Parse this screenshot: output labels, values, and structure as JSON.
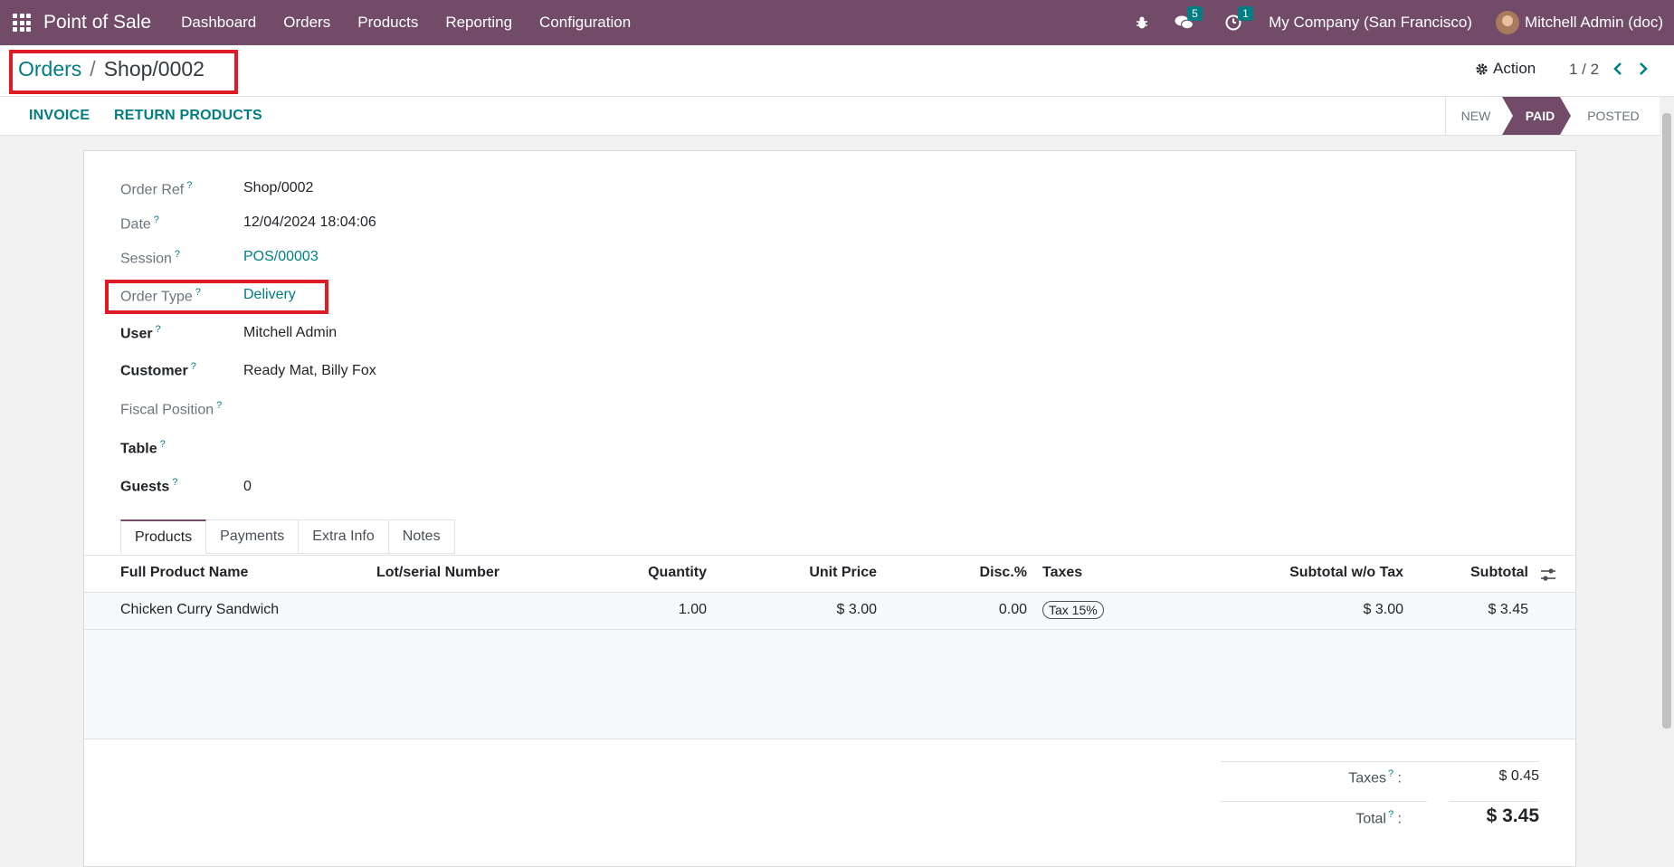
{
  "navbar": {
    "app_title": "Point of Sale",
    "menu": [
      "Dashboard",
      "Orders",
      "Products",
      "Reporting",
      "Configuration"
    ],
    "messages_count": "5",
    "activities_count": "1",
    "company": "My Company (San Francisco)",
    "user": "Mitchell Admin (doc)"
  },
  "breadcrumb": {
    "parent": "Orders",
    "separator": "/",
    "current": "Shop/0002"
  },
  "control": {
    "action_label": "Action",
    "pager": "1 / 2"
  },
  "status_bar": {
    "buttons": [
      "INVOICE",
      "RETURN PRODUCTS"
    ],
    "stages": [
      "NEW",
      "PAID",
      "POSTED"
    ],
    "active_stage": "PAID"
  },
  "form": {
    "fields": [
      {
        "label": "Order Ref",
        "value": "Shop/0002"
      },
      {
        "label": "Date",
        "value": "12/04/2024 18:04:06"
      },
      {
        "label": "Session",
        "value": "POS/00003"
      },
      {
        "label": "Order Type",
        "value": "Delivery"
      },
      {
        "label": "User",
        "value": "Mitchell Admin"
      },
      {
        "label": "Customer",
        "value": "Ready Mat, Billy Fox"
      },
      {
        "label": "Fiscal Position",
        "value": ""
      },
      {
        "label": "Table",
        "value": ""
      },
      {
        "label": "Guests",
        "value": "0"
      }
    ],
    "help_mark": "?"
  },
  "tabs": [
    "Products",
    "Payments",
    "Extra Info",
    "Notes"
  ],
  "table": {
    "headers": [
      "Full Product Name",
      "Lot/serial Number",
      "Quantity",
      "Unit Price",
      "Disc.%",
      "Taxes",
      "Subtotal w/o Tax",
      "Subtotal"
    ],
    "rows": [
      {
        "product": "Chicken Curry Sandwich",
        "lot": "",
        "quantity": "1.00",
        "unit_price": "$ 3.00",
        "discount": "0.00",
        "taxes": "Tax 15%",
        "subtotal_wo_tax": "$ 3.00",
        "subtotal": "$ 3.45"
      }
    ]
  },
  "totals": {
    "taxes_label": "Taxes",
    "taxes_value": "$ 0.45",
    "total_label": "Total",
    "total_value": "$ 3.45"
  },
  "colors": {
    "brand": "#714b67",
    "accent": "#017e84",
    "highlight": "#e01b24"
  }
}
